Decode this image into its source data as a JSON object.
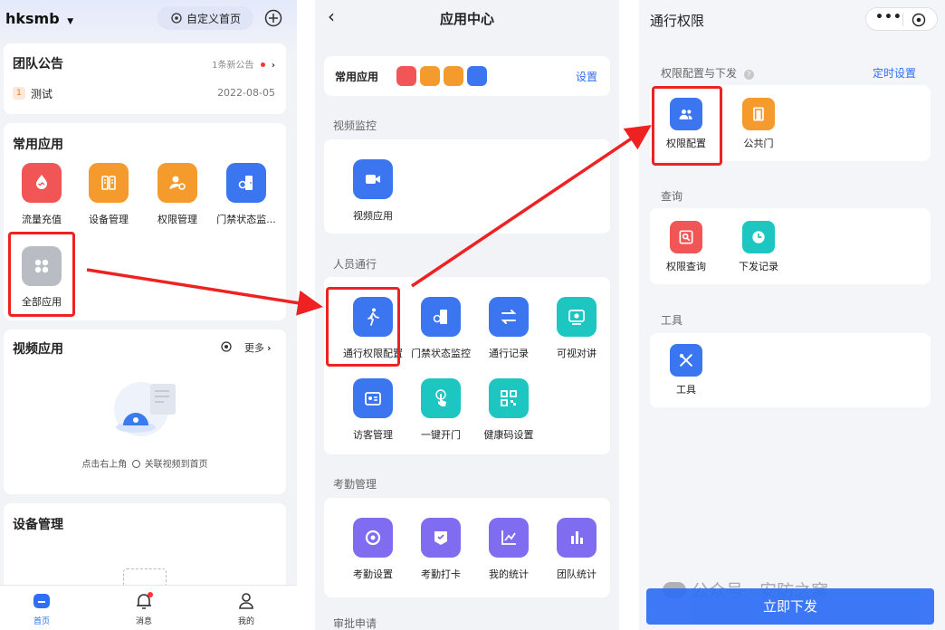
{
  "home": {
    "brand": "hksmb",
    "customize_home": "自定义首页",
    "notice": {
      "title": "团队公告",
      "badge_text": "1条新公告",
      "tag": "1",
      "item": "测试",
      "date": "2022-08-05"
    },
    "common": {
      "title": "常用应用",
      "apps": [
        "流量充值",
        "设备管理",
        "权限管理",
        "门禁状态监..."
      ],
      "all_apps": "全部应用"
    },
    "video": {
      "title": "视频应用",
      "more": "更多",
      "hint_pre": "点击右上角",
      "hint_post": "关联视频到首页"
    },
    "device": {
      "title": "设备管理"
    },
    "tabbar": [
      "首页",
      "消息",
      "我的"
    ]
  },
  "app_center": {
    "title": "应用中心",
    "common_label": "常用应用",
    "settings": "设置",
    "sections": [
      {
        "title": "视频监控",
        "apps": [
          "视频应用"
        ]
      },
      {
        "title": "人员通行",
        "apps": [
          "通行权限配置",
          "门禁状态监控",
          "通行记录",
          "可视对讲",
          "访客管理",
          "一键开门",
          "健康码设置"
        ]
      },
      {
        "title": "考勤管理",
        "apps": [
          "考勤设置",
          "考勤打卡",
          "我的统计",
          "团队统计"
        ]
      },
      {
        "title": "审批申请"
      }
    ]
  },
  "access": {
    "title": "通行权限",
    "sec1": "权限配置与下发",
    "timed": "定时设置",
    "sec1_apps": [
      "权限配置",
      "公共门"
    ],
    "sec2": "查询",
    "sec2_apps": [
      "权限查询",
      "下发记录"
    ],
    "sec3": "工具",
    "sec3_apps": [
      "工具"
    ],
    "issue_button": "立即下发",
    "watermark": "公众号 · 安防之窝"
  },
  "colors": {
    "accent": "#2f6ef6",
    "highlight": "#ee2222",
    "orange": "#f59a2c",
    "red": "#f25555",
    "teal": "#1dc6c0",
    "purple": "#7f6cf0"
  }
}
